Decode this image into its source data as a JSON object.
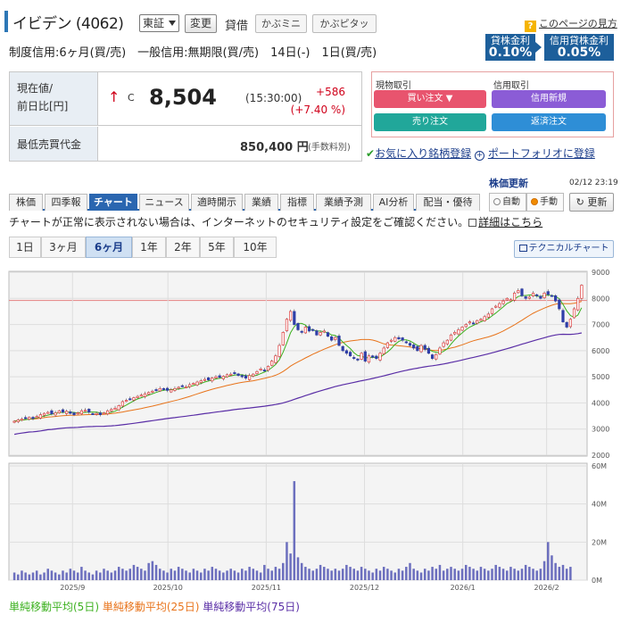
{
  "header": {
    "title": "イビデン (4062)",
    "market_select": "東証",
    "change_button": "変更",
    "taishaku": "貸借",
    "kabu_mini": "かぶミニ",
    "kabu_pitta": "かぶピタッ",
    "help_label": "このページの見方"
  },
  "margin": {
    "info": "制度信用:6ヶ月(買/売)　一般信用:無期限(買/売)　14日(-)　1日(買/売)",
    "rate1_label": "貸株金利",
    "rate1_value": "0.10%",
    "rate2_label": "信用貸株金利",
    "rate2_value": "0.05%"
  },
  "price": {
    "label_line1": "現在値/",
    "label_line2": "前日比[円]",
    "arrow": "↑",
    "c_mark": "C",
    "value": "8,504",
    "time": "(15:30:00)",
    "change": "+586",
    "change_pct": "(+7.40 %)",
    "min_label": "最低売買代金",
    "min_value": "850,400 円",
    "fee_note": "(手数料別)"
  },
  "trade": {
    "cash_label": "現物取引",
    "margin_label": "信用取引",
    "buy": "買い注文 ▼",
    "margin_new": "信用新規",
    "sell": "売り注文",
    "repay": "返済注文",
    "buy_color": "#e8546e",
    "margin_new_color": "#8b5cd6",
    "sell_color": "#21a79a",
    "repay_color": "#2e8ed6"
  },
  "links": {
    "favorite": "お気に入り銘柄登録",
    "portfolio": "ポートフォリオに登録"
  },
  "update": {
    "title": "株価更新",
    "timestamp": "02/12 23:19",
    "auto": "自動",
    "manual": "手動",
    "refresh": "更新"
  },
  "tabs": [
    "株価",
    "四季報",
    "チャート",
    "ニュース",
    "適時開示",
    "業績",
    "指標",
    "業績予測",
    "AI分析",
    "配当・優待"
  ],
  "notice": {
    "text": "チャートが正常に表示されない場合は、インターネットのセキュリティ設定をご確認ください。",
    "link": "詳細はこちら"
  },
  "periods": [
    "1日",
    "3ヶ月",
    "6ヶ月",
    "1年",
    "2年",
    "5年",
    "10年"
  ],
  "technical_button": "テクニカルチャート",
  "chart_data": {
    "type": "candlestick",
    "price_axis": {
      "min": 2000,
      "max": 9000,
      "ticks": [
        "9000",
        "8000",
        "7000",
        "6000",
        "5000",
        "4000",
        "3000",
        "2000"
      ]
    },
    "volume_axis": {
      "max": 60,
      "ticks": [
        "60M",
        "40M",
        "20M",
        "0M"
      ]
    },
    "reference_line": 7918,
    "x_labels": [
      "2025/9",
      "2025/10",
      "2025/11",
      "2025/12",
      "2026/1",
      "2026/2"
    ],
    "closes": [
      3300,
      3350,
      3380,
      3420,
      3450,
      3400,
      3480,
      3550,
      3600,
      3640,
      3580,
      3620,
      3700,
      3650,
      3680,
      3600,
      3550,
      3620,
      3700,
      3720,
      3650,
      3580,
      3600,
      3550,
      3620,
      3700,
      3750,
      3800,
      3900,
      4050,
      4100,
      4150,
      4200,
      4250,
      4300,
      4350,
      4400,
      4450,
      4500,
      4550,
      4520,
      4480,
      4500,
      4550,
      4600,
      4650,
      4620,
      4700,
      4750,
      4800,
      4850,
      4900,
      4880,
      4950,
      5000,
      4980,
      5020,
      5080,
      5100,
      5150,
      5050,
      5000,
      4950,
      5050,
      5100,
      5200,
      5300,
      5250,
      5400,
      5600,
      5800,
      6200,
      6700,
      7200,
      7500,
      7000,
      6800,
      6700,
      6900,
      6750,
      6800,
      6600,
      6700,
      6750,
      6550,
      6400,
      6500,
      6200,
      6000,
      5900,
      5800,
      5700,
      5650,
      5900,
      5600,
      5800,
      5750,
      5700,
      5900,
      6100,
      6300,
      6400,
      6500,
      6450,
      6400,
      6300,
      6200,
      6100,
      6000,
      6200,
      6050,
      5900,
      5700,
      5850,
      6100,
      6300,
      6400,
      6600,
      6700,
      6800,
      6900,
      7000,
      7100,
      7050,
      7150,
      7200,
      7300,
      7400,
      7600,
      7700,
      7800,
      7900,
      8000,
      7950,
      8200,
      8300,
      8100,
      8000,
      8050,
      8200,
      8100,
      8000,
      8200,
      8150,
      8100,
      7900,
      7600,
      7100,
      6900,
      7200,
      7600,
      8000,
      8504
    ],
    "volumes": [
      4,
      3,
      5,
      4,
      3,
      4,
      5,
      3,
      4,
      6,
      5,
      4,
      3,
      5,
      4,
      6,
      5,
      4,
      7,
      5,
      4,
      3,
      5,
      4,
      6,
      5,
      4,
      5,
      7,
      6,
      5,
      6,
      8,
      7,
      6,
      5,
      9,
      10,
      8,
      6,
      5,
      4,
      6,
      5,
      7,
      6,
      5,
      4,
      6,
      5,
      4,
      6,
      5,
      7,
      6,
      5,
      4,
      5,
      6,
      5,
      4,
      6,
      5,
      7,
      6,
      5,
      4,
      8,
      6,
      5,
      7,
      6,
      9,
      20,
      14,
      52,
      12,
      9,
      7,
      6,
      5,
      6,
      8,
      7,
      6,
      5,
      6,
      5,
      6,
      8,
      7,
      6,
      5,
      7,
      6,
      5,
      4,
      6,
      5,
      7,
      6,
      5,
      4,
      6,
      5,
      7,
      9,
      6,
      5,
      4,
      6,
      5,
      7,
      6,
      8,
      5,
      6,
      7,
      6,
      5,
      6,
      8,
      7,
      6,
      5,
      7,
      6,
      5,
      6,
      8,
      7,
      6,
      5,
      7,
      6,
      5,
      6,
      8,
      7,
      6,
      5,
      6,
      10,
      20,
      13,
      9,
      7,
      8,
      6,
      7
    ]
  },
  "legend": {
    "ma5": "単純移動平均(5日)",
    "ma25": "単純移動平均(25日)",
    "ma75": "単純移動平均(75日)",
    "ma5_color": "#3cb11f",
    "ma25_color": "#e8731a",
    "ma75_color": "#5a2ea6"
  }
}
